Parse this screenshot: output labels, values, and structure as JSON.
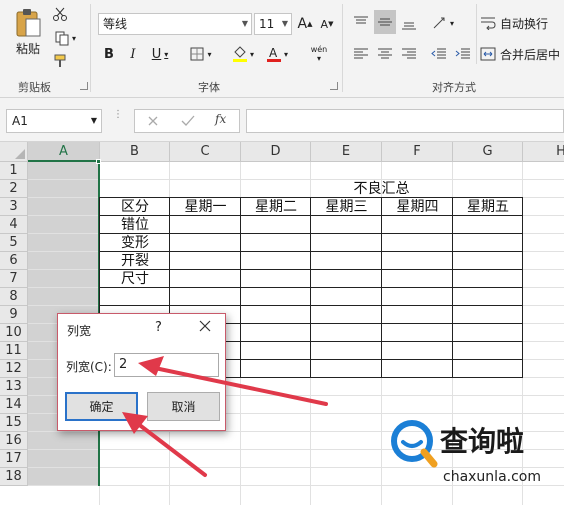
{
  "ribbon": {
    "clipboard": {
      "paste_label": "粘贴",
      "group_label": "剪贴板"
    },
    "font": {
      "font_name": "等线",
      "font_size": "11",
      "group_label": "字体",
      "bold": "B",
      "italic": "I",
      "underline": "U",
      "grow": "A",
      "shrink": "A",
      "phonetic": "wén"
    },
    "alignment": {
      "wrap_label": "自动换行",
      "merge_label": "合并后居中",
      "group_label": "对齐方式"
    }
  },
  "formula_bar": {
    "name_box": "A1",
    "fx": "fx",
    "value": ""
  },
  "sheet": {
    "columns": [
      "A",
      "B",
      "C",
      "D",
      "E",
      "F",
      "G",
      "H"
    ],
    "rows": [
      "1",
      "2",
      "3",
      "4",
      "5",
      "6",
      "7",
      "8",
      "9",
      "10",
      "11",
      "12",
      "13",
      "14",
      "15",
      "16",
      "17",
      "18"
    ],
    "table_title": "不良汇总",
    "header_row": [
      "区分",
      "星期一",
      "星期二",
      "星期三",
      "星期四",
      "星期五"
    ],
    "categories": [
      "错位",
      "变形",
      "开裂",
      "尺寸"
    ]
  },
  "dialog": {
    "title": "列宽",
    "help": "?",
    "field_label": "列宽(C):",
    "field_value": "2",
    "ok_label": "确定",
    "cancel_label": "取消"
  },
  "watermark": {
    "brand": "查询啦",
    "domain": "chaxunla.com"
  },
  "colors": {
    "accent_red": "#e0394a",
    "selected_column": "#d2d2d2",
    "ok_border": "#2a72c9",
    "sheet_selection": "#217346"
  }
}
